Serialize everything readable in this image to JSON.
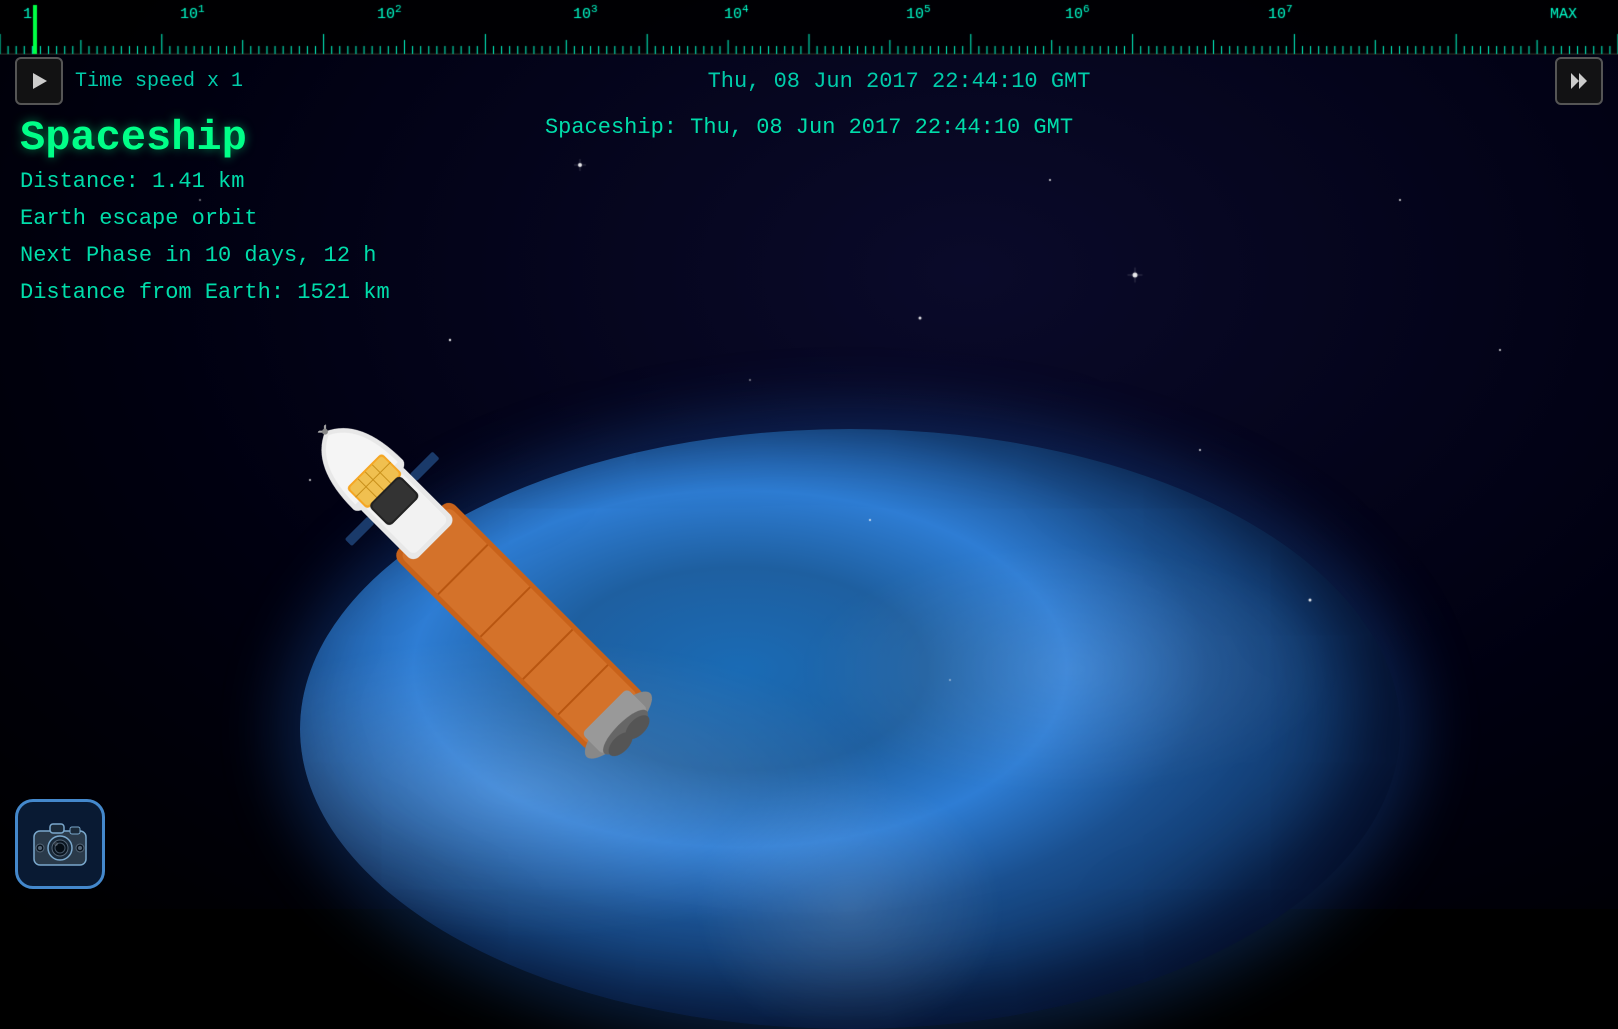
{
  "timeline": {
    "labels": [
      "1",
      "10¹",
      "10²",
      "10³",
      "10⁴",
      "10⁵",
      "10⁶",
      "10⁷",
      "MAX"
    ],
    "raw": [
      "1",
      "10",
      "10",
      "10",
      "10",
      "10",
      "10",
      "10",
      "MAX"
    ],
    "exponents": [
      "",
      "1",
      "2",
      "3",
      "4",
      "5",
      "6",
      "7",
      ""
    ]
  },
  "top_bar": {
    "play_button_label": "▶",
    "fast_forward_label": "⏭",
    "time_speed": "Time speed x 1",
    "datetime": "Thu, 08 Jun 2017  22:44:10 GMT"
  },
  "hud": {
    "name": "Spaceship",
    "distance": "Distance:  1.41 km",
    "orbit_type": "Earth escape orbit",
    "next_phase": "Next Phase in 10 days, 12 h",
    "distance_from_earth": "Distance from Earth: 1521 km",
    "spaceship_datetime": "Spaceship:  Thu, 08 Jun 2017  22:44:10 GMT"
  },
  "camera_button": {
    "icon": "camera-icon"
  },
  "colors": {
    "hud_primary": "#00ff88",
    "hud_secondary": "#00ddaa",
    "timeline_text": "#00ffcc",
    "control_bg": "#141414",
    "control_border": "#555555"
  }
}
